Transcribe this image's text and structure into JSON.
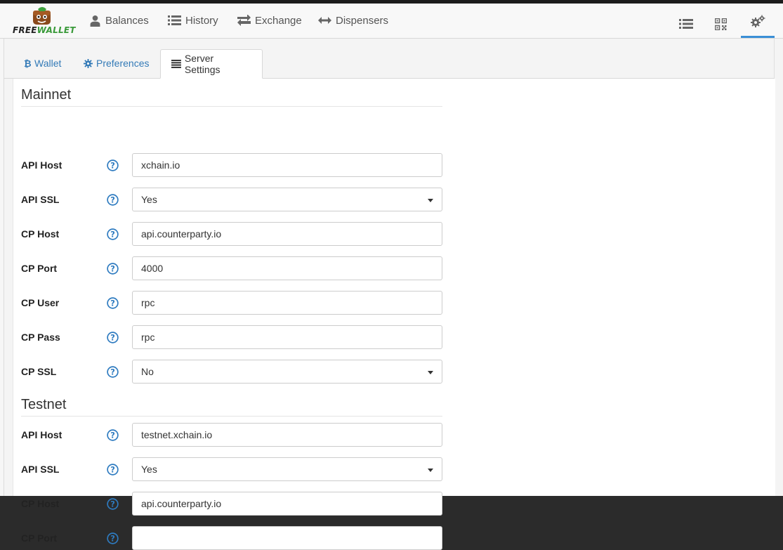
{
  "brand": {
    "free": "FREE",
    "wallet": "WALLET"
  },
  "nav": {
    "items": [
      {
        "label": "Balances",
        "icon": "user-icon"
      },
      {
        "label": "History",
        "icon": "list-icon"
      },
      {
        "label": "Exchange",
        "icon": "exchange-arrows-icon"
      },
      {
        "label": "Dispensers",
        "icon": "horizontal-arrows-icon"
      }
    ],
    "right": [
      "list-view-icon",
      "qr-code-icon",
      "gears-icon"
    ]
  },
  "tabs": [
    {
      "label": "Wallet",
      "icon": "bitcoin-icon"
    },
    {
      "label": "Preferences",
      "icon": "gear-icon"
    },
    {
      "label": "Server Settings",
      "icon": "server-list-icon"
    }
  ],
  "colors": {
    "link": "#337ab7",
    "help": "#2e7bc0",
    "active_underline": "#3a8fd6",
    "brand_green": "#3a9a3a"
  },
  "mainnet": {
    "title": "Mainnet",
    "fields": [
      {
        "label": "API Host",
        "value": "xchain.io"
      },
      {
        "label": "API SSL",
        "value": "Yes"
      },
      {
        "label": "CP Host",
        "value": "api.counterparty.io"
      },
      {
        "label": "CP Port",
        "value": "4000"
      },
      {
        "label": "CP User",
        "value": "rpc"
      },
      {
        "label": "CP Pass",
        "value": "rpc"
      },
      {
        "label": "CP SSL",
        "value": "No"
      }
    ]
  },
  "testnet": {
    "title": "Testnet",
    "fields": [
      {
        "label": "API Host",
        "value": "testnet.xchain.io"
      },
      {
        "label": "API SSL",
        "value": "Yes"
      },
      {
        "label": "CP Host",
        "value": "api.counterparty.io"
      },
      {
        "label": "CP Port",
        "value": ""
      }
    ]
  }
}
